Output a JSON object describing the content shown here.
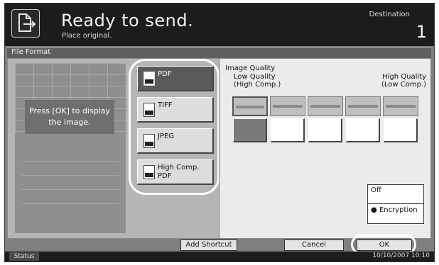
{
  "header": {
    "title": "Ready to send.",
    "subtitle": "Place original.",
    "destination_label": "Destination",
    "destination_count": "1"
  },
  "title_bar": {
    "label": "File Format"
  },
  "preview": {
    "message": "Press [OK] to display the image."
  },
  "file_formats": {
    "selected": "PDF",
    "items": [
      {
        "label": "PDF",
        "icon": "pdf-file-icon"
      },
      {
        "label": "TIFF",
        "icon": "tiff-file-icon"
      },
      {
        "label": "JPEG",
        "icon": "jpeg-file-icon"
      },
      {
        "label": "High Comp. PDF",
        "icon": "high-comp-pdf-file-icon"
      }
    ]
  },
  "image_quality": {
    "title": "Image Quality",
    "low_label": "Low Quality\n(High Comp.)",
    "high_label": "High Quality\n(Low Comp.)",
    "levels": 5,
    "selected_level": 1
  },
  "encryption": {
    "off_label": "Off",
    "on_label": "Encryption",
    "selected": "Off"
  },
  "buttons": {
    "add_shortcut": "Add Shortcut",
    "cancel": "Cancel",
    "ok": "OK"
  },
  "status_bar": {
    "status_label": "Status",
    "datetime": "10/10/2007  10:10"
  },
  "colors": {
    "header_bg": "#1c1c1c",
    "panel_bg": "#b5b5b5",
    "quality_panel_bg": "#ebebeb",
    "selected_button": "#5a5a5a"
  }
}
